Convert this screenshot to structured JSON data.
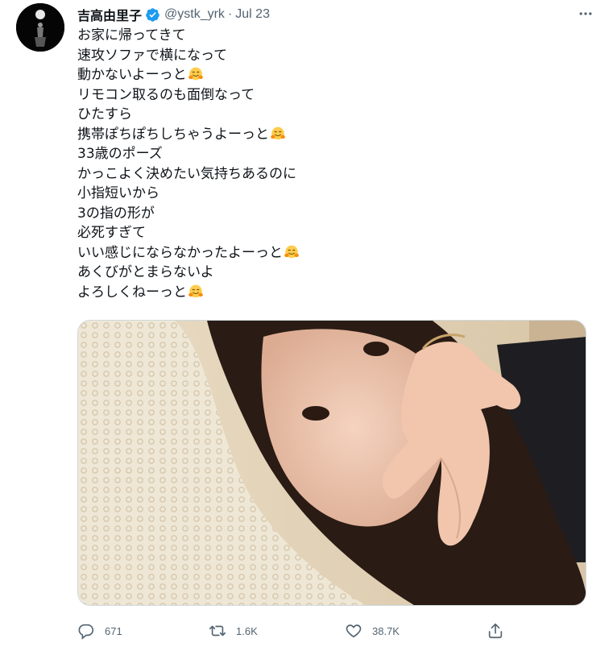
{
  "tweet": {
    "display_name": "吉高由里子",
    "handle": "@ystk_yrk",
    "separator": "·",
    "date": "Jul 23",
    "lines": [
      {
        "text": "お家に帰ってきて",
        "emoji": false
      },
      {
        "text": "速攻ソファで横になって",
        "emoji": false
      },
      {
        "text": "動かないよーっと",
        "emoji": true
      },
      {
        "text": "リモコン取るのも面倒なって",
        "emoji": false
      },
      {
        "text": "ひたすら",
        "emoji": false
      },
      {
        "text": "携帯ぽちぽちしちゃうよーっと",
        "emoji": true
      },
      {
        "text": "33歳のポーズ",
        "emoji": false
      },
      {
        "text": "かっこよく決めたい気持ちあるのに",
        "emoji": false
      },
      {
        "text": "小指短いから",
        "emoji": false
      },
      {
        "text": "3の指の形が",
        "emoji": false
      },
      {
        "text": "必死すぎて",
        "emoji": false
      },
      {
        "text": "いい感じにならなかったよーっと",
        "emoji": true
      },
      {
        "text": "あくびがとまらないよ",
        "emoji": false
      },
      {
        "text": "よろしくねーっと",
        "emoji": true
      }
    ],
    "emoji_name": "hugging-face-emoji"
  },
  "actions": {
    "reply_count": "671",
    "retweet_count": "1.6K",
    "like_count": "38.7K"
  },
  "icons": {
    "verified": "verified-badge-icon",
    "more": "more-dots-icon",
    "reply": "reply-icon",
    "retweet": "retweet-icon",
    "like": "heart-icon",
    "share": "share-icon"
  },
  "colors": {
    "verified_blue": "#1d9bf0",
    "secondary_text": "#536471",
    "primary_text": "#0f1419"
  }
}
